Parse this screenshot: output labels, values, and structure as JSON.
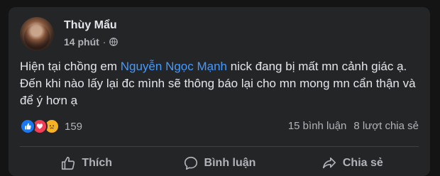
{
  "post": {
    "author": "Thùy Mẩu",
    "time": "14 phút",
    "separator": "·",
    "privacy_icon": "globe-icon",
    "text_before": "Hiện tại chồng em ",
    "mention": "Nguyễn Ngọc Mạnh",
    "text_after": "  nick đang bị mất mn cảnh giác ạ. Đến khi nào lấy lại đc mình sẽ thông báo lại cho mn mong mn cẩn thận và để ý hơn ạ"
  },
  "stats": {
    "reactions": [
      "like-reaction-icon",
      "love-reaction-icon",
      "sad-reaction-icon"
    ],
    "reaction_count": "159",
    "comments": "15 bình luận",
    "shares": "8 lượt chia sẻ"
  },
  "actions": {
    "like": "Thích",
    "comment": "Bình luận",
    "share": "Chia sẻ"
  },
  "colors": {
    "background": "#141414",
    "card": "#242526",
    "mention": "#4599ff",
    "like": "#1877f2",
    "love": "#f33e58",
    "sad": "#f7b125"
  }
}
